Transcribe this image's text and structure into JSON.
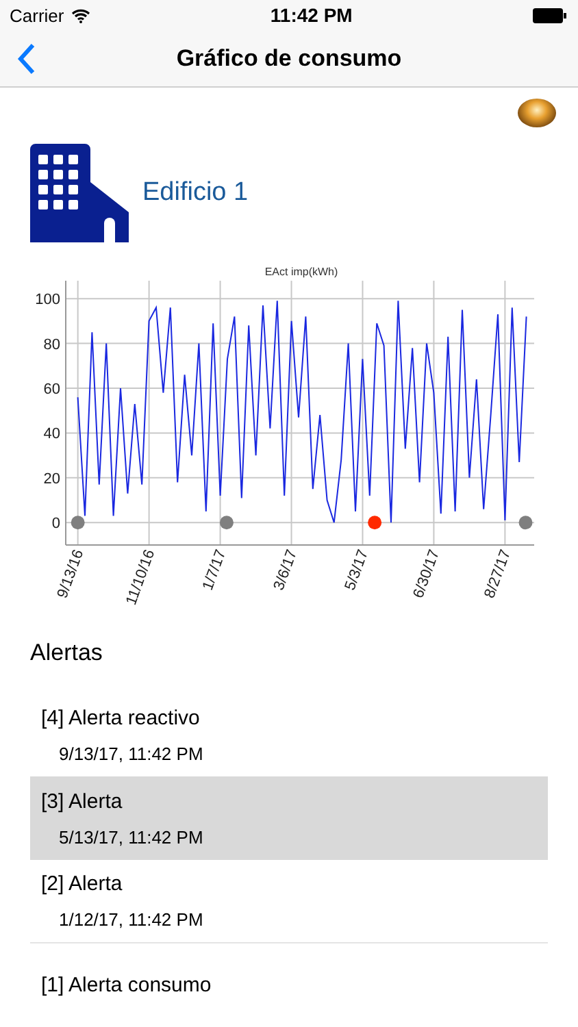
{
  "status_bar": {
    "carrier": "Carrier",
    "time": "11:42 PM"
  },
  "nav": {
    "title": "Gráfico de consumo"
  },
  "building": {
    "name": "Edificio 1"
  },
  "chart_data": {
    "type": "line",
    "grid": true,
    "title": "EAct imp(kWh)",
    "ylim": [
      -10,
      108
    ],
    "yticks": [
      0,
      20,
      40,
      60,
      80,
      100
    ],
    "categories": [
      "9/13/16",
      null,
      null,
      null,
      null,
      null,
      null,
      null,
      null,
      null,
      "11/10/16",
      null,
      null,
      null,
      null,
      null,
      null,
      null,
      null,
      null,
      "1/7/17",
      null,
      null,
      null,
      null,
      null,
      null,
      null,
      null,
      null,
      "3/6/17",
      null,
      null,
      null,
      null,
      null,
      null,
      null,
      null,
      null,
      "5/3/17",
      null,
      null,
      null,
      null,
      null,
      null,
      null,
      null,
      null,
      "6/30/17",
      null,
      null,
      null,
      null,
      null,
      null,
      null,
      null,
      null,
      "8/27/17",
      null,
      null,
      null
    ],
    "series": [
      {
        "color": "#1a28e0",
        "values": [
          56,
          3,
          85,
          17,
          80,
          3,
          60,
          13,
          53,
          17,
          90,
          96,
          58,
          96,
          18,
          66,
          30,
          80,
          5,
          89,
          12,
          73,
          92,
          11,
          88,
          30,
          97,
          42,
          99,
          12,
          90,
          47,
          92,
          15,
          48,
          10,
          0,
          28,
          80,
          5,
          73,
          12,
          89,
          79,
          0,
          99,
          33,
          78,
          18,
          80,
          58,
          4,
          83,
          5,
          95,
          20,
          64,
          6,
          48,
          93,
          1,
          96,
          27,
          92
        ]
      }
    ]
  },
  "alerts_title": "Alertas",
  "alerts": [
    {
      "title": "[4] Alerta reactivo",
      "date": "9/13/17, 11:42 PM",
      "selected": false
    },
    {
      "title": "[3] Alerta",
      "date": "5/13/17, 11:42 PM",
      "selected": true
    },
    {
      "title": "[2] Alerta",
      "date": "1/12/17, 11:42 PM",
      "selected": false
    },
    {
      "title": "[1] Alerta consumo",
      "selected": false
    }
  ]
}
